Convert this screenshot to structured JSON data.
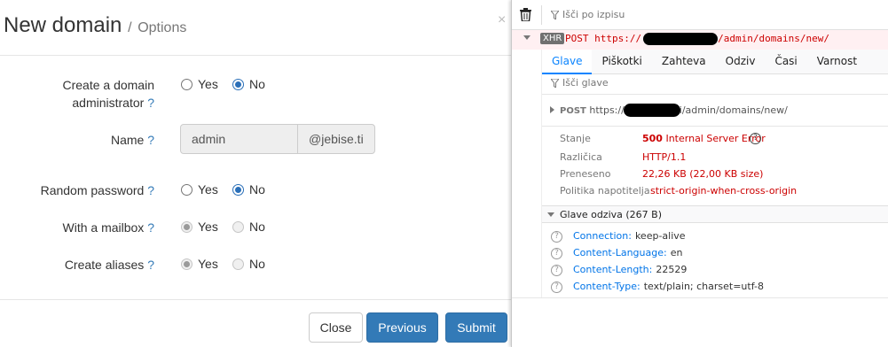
{
  "modal": {
    "title": "New domain",
    "separator": "/",
    "subtitle": "Options",
    "close_glyph": "×",
    "fields": {
      "create_admin": {
        "label_line1": "Create a domain",
        "label_line2": "administrator",
        "help": "?",
        "yes": "Yes",
        "no": "No",
        "selected": "No",
        "disabled": false
      },
      "name": {
        "label": "Name",
        "help": "?",
        "value": "admin",
        "addon": "@jebise.ti"
      },
      "random_password": {
        "label": "Random password",
        "help": "?",
        "yes": "Yes",
        "no": "No",
        "selected": "No",
        "disabled": false
      },
      "with_mailbox": {
        "label": "With a mailbox",
        "help": "?",
        "yes": "Yes",
        "no": "No",
        "selected": "Yes",
        "disabled": true
      },
      "create_aliases": {
        "label": "Create aliases",
        "help": "?",
        "yes": "Yes",
        "no": "No",
        "selected": "Yes",
        "disabled": true
      }
    },
    "buttons": {
      "close": "Close",
      "previous": "Previous",
      "submit": "Submit"
    }
  },
  "devtools": {
    "filter_placeholder": "Išči po izpisu",
    "request": {
      "badge": "XHR",
      "method": "POST",
      "url_prefix": "https://",
      "url_suffix": "/admin/domains/new/"
    },
    "tabs": [
      "Glave",
      "Piškotki",
      "Zahteva",
      "Odziv",
      "Časi",
      "Varnost"
    ],
    "active_tab": "Glave",
    "headers_filter_placeholder": "Išči glave",
    "summary_line": {
      "method": "POST",
      "url_prefix": "https://",
      "url_suffix": "i/admin/domains/new/"
    },
    "status": {
      "stanje_label": "Stanje",
      "stanje_code": "500",
      "stanje_text": "Internal Server Error",
      "stanje_help": "?",
      "razlicica_label": "Različica",
      "razlicica_value": "HTTP/1.1",
      "preneseno_label": "Preneseno",
      "preneseno_value": "22,26 KB (22,00 KB size)",
      "politika_label": "Politika napotitelja",
      "politika_value": "strict-origin-when-cross-origin"
    },
    "response_headers_title": "Glave odziva (267 B)",
    "response_headers": [
      {
        "name": "Connection:",
        "value": "keep-alive",
        "help": "?"
      },
      {
        "name": "Content-Language:",
        "value": "en",
        "help": "?"
      },
      {
        "name": "Content-Length:",
        "value": "22529",
        "help": "?"
      },
      {
        "name": "Content-Type:",
        "value": "text/plain; charset=utf-8",
        "help": "?"
      }
    ],
    "colors": {
      "accent": "#0a84ff",
      "error": "#cc0000",
      "request_row_bg": "#fff0f2",
      "primary_button": "#337ab7"
    }
  }
}
